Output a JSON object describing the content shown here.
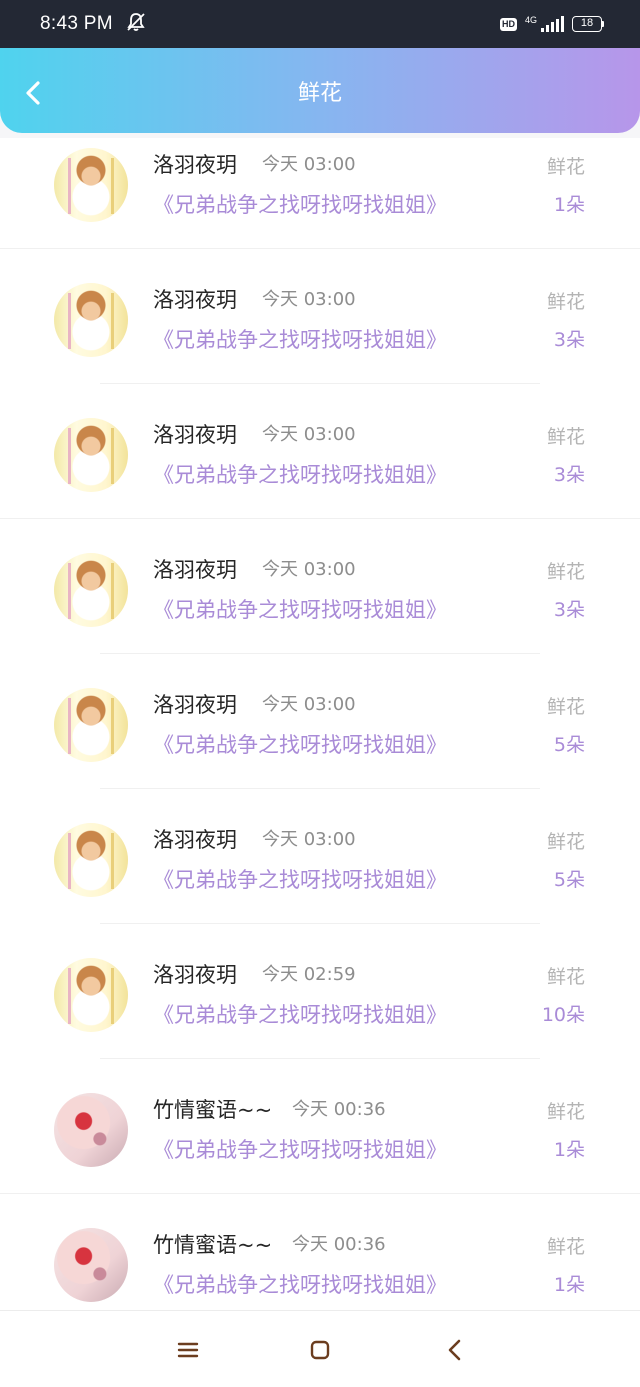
{
  "status_bar": {
    "time": "8:43 PM",
    "hd_label": "HD",
    "network_label": "4G",
    "battery_level": "18",
    "icons": [
      "mute-bell-icon",
      "hd-icon",
      "signal-icon",
      "battery-icon"
    ]
  },
  "header": {
    "title": "鲜花",
    "back_icon": "chevron-left-icon",
    "gradient_colors": [
      "#4fd3ee",
      "#86b6f0",
      "#b796ea"
    ]
  },
  "colors": {
    "accent": "#a98bd7",
    "muted_text": "#8d8d8d",
    "label_text": "#b4b4b4"
  },
  "list": {
    "items": [
      {
        "user": "洛羽夜玥",
        "time": "今天 03:00",
        "book": "《兄弟战争之找呀找呀找姐姐》",
        "gift_label": "鲜花",
        "gift_count": "1朵",
        "avatar": "sakura-avatar"
      },
      {
        "user": "洛羽夜玥",
        "time": "今天 03:00",
        "book": "《兄弟战争之找呀找呀找姐姐》",
        "gift_label": "鲜花",
        "gift_count": "3朵",
        "avatar": "sakura-avatar"
      },
      {
        "user": "洛羽夜玥",
        "time": "今天 03:00",
        "book": "《兄弟战争之找呀找呀找姐姐》",
        "gift_label": "鲜花",
        "gift_count": "3朵",
        "avatar": "sakura-avatar"
      },
      {
        "user": "洛羽夜玥",
        "time": "今天 03:00",
        "book": "《兄弟战争之找呀找呀找姐姐》",
        "gift_label": "鲜花",
        "gift_count": "3朵",
        "avatar": "sakura-avatar"
      },
      {
        "user": "洛羽夜玥",
        "time": "今天 03:00",
        "book": "《兄弟战争之找呀找呀找姐姐》",
        "gift_label": "鲜花",
        "gift_count": "5朵",
        "avatar": "sakura-avatar"
      },
      {
        "user": "洛羽夜玥",
        "time": "今天 03:00",
        "book": "《兄弟战争之找呀找呀找姐姐》",
        "gift_label": "鲜花",
        "gift_count": "5朵",
        "avatar": "sakura-avatar"
      },
      {
        "user": "洛羽夜玥",
        "time": "今天 02:59",
        "book": "《兄弟战争之找呀找呀找姐姐》",
        "gift_label": "鲜花",
        "gift_count": "10朵",
        "avatar": "sakura-avatar"
      },
      {
        "user": "竹情蜜语~~",
        "time": "今天 00:36",
        "book": "《兄弟战争之找呀找呀找姐姐》",
        "gift_label": "鲜花",
        "gift_count": "1朵",
        "avatar": "lips-avatar"
      },
      {
        "user": "竹情蜜语~~",
        "time": "今天 00:36",
        "book": "《兄弟战争之找呀找呀找姐姐》",
        "gift_label": "鲜花",
        "gift_count": "1朵",
        "avatar": "lips-avatar"
      }
    ]
  },
  "nav_bar": {
    "buttons": [
      "menu-icon",
      "home-icon",
      "back-icon"
    ]
  }
}
